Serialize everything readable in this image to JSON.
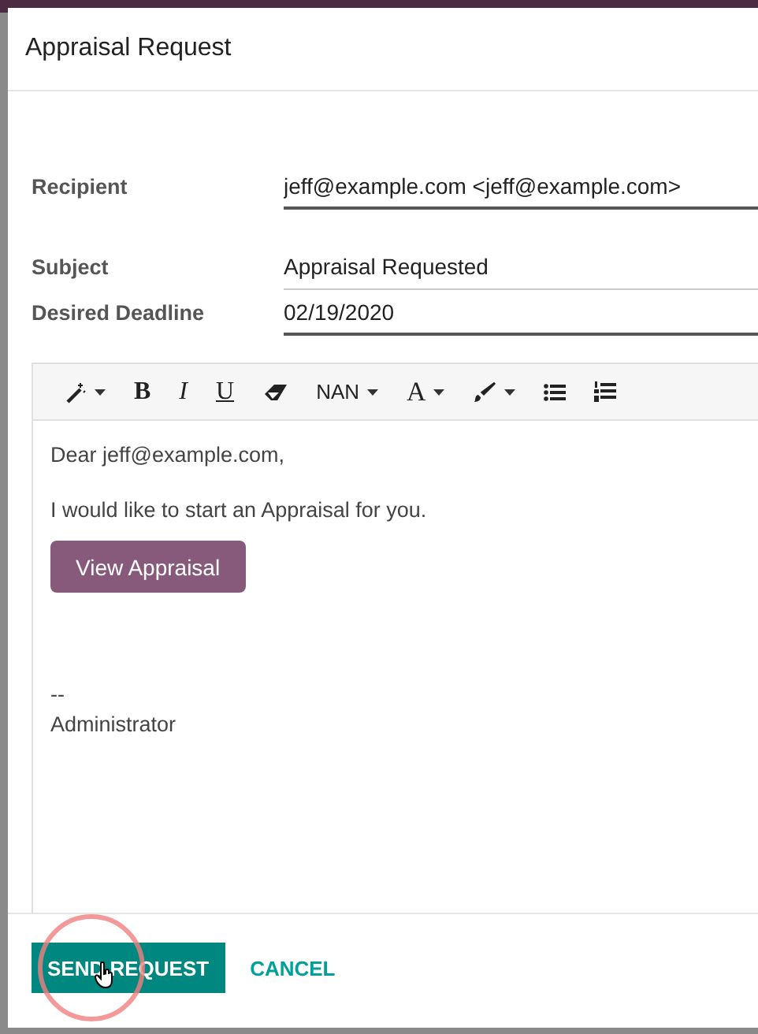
{
  "dialog": {
    "title": "Appraisal Request"
  },
  "fields": [
    {
      "label": "Recipient",
      "value": "jeff@example.com <jeff@example.com>",
      "kind": "many2one"
    },
    {
      "label": "Subject",
      "value": "Appraisal Requested",
      "kind": "text"
    },
    {
      "label": "Desired Deadline",
      "value": "02/19/2020",
      "kind": "date"
    }
  ],
  "toolbar": [
    {
      "kind": "wand"
    },
    {
      "kind": "bold",
      "text": "B"
    },
    {
      "kind": "italic",
      "text": "I"
    },
    {
      "kind": "underline",
      "text": "U"
    },
    {
      "kind": "eraser"
    },
    {
      "kind": "size",
      "text": "NAN"
    },
    {
      "kind": "color",
      "text": "A"
    },
    {
      "kind": "brush"
    },
    {
      "kind": "bullets"
    },
    {
      "kind": "numbers"
    }
  ],
  "body": {
    "greeting": "Dear jeff@example.com,",
    "message": "I would like to start an Appraisal for you.",
    "link_button": "View Appraisal",
    "signature_separator": "--",
    "signature": "Administrator"
  },
  "footer": {
    "buttons": [
      {
        "label": "SEND REQUEST",
        "kind": "primary"
      },
      {
        "label": "CANCEL",
        "kind": "link"
      }
    ]
  }
}
